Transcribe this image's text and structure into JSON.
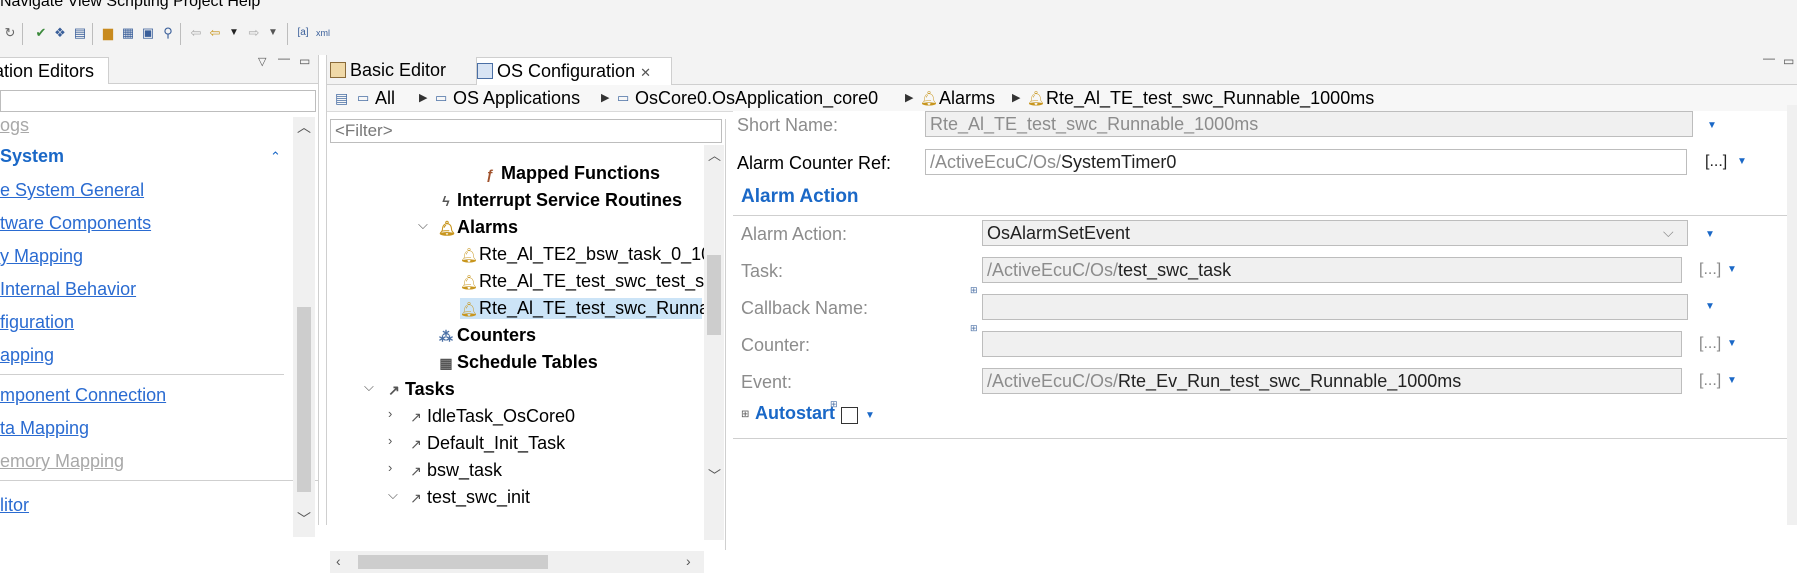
{
  "menu": {
    "text": "Navigate  View  Scripting  Project  Help"
  },
  "left_panel": {
    "tab_label": "ation Editors",
    "items": [
      {
        "label": "ogs",
        "style": "grey"
      },
      {
        "label": "System",
        "style": "sys"
      },
      {
        "label": "e System General",
        "style": "link"
      },
      {
        "label": "tware Components",
        "style": "link"
      },
      {
        "label": "y Mapping",
        "style": "link"
      },
      {
        "label": " Internal Behavior",
        "style": "link"
      },
      {
        "label": "figuration",
        "style": "link"
      },
      {
        "label": "apping",
        "style": "link"
      },
      {
        "label": "mponent Connection",
        "style": "link"
      },
      {
        "label": "ta Mapping",
        "style": "link"
      },
      {
        "label": "emory Mapping",
        "style": "grey"
      },
      {
        "label": "litor",
        "style": "link"
      }
    ]
  },
  "editor": {
    "tabs": [
      {
        "label": "Basic Editor"
      },
      {
        "label": "OS Configuration"
      }
    ],
    "breadcrumb": [
      "All",
      "OS Applications",
      "OsCore0.OsApplication_core0",
      "Alarms",
      "Rte_Al_TE_test_swc_Runnable_1000ms"
    ]
  },
  "tree": {
    "filter_placeholder": "<Filter>",
    "items": [
      {
        "label": "Mapped Functions",
        "icon": "function-icon"
      },
      {
        "label": "Interrupt Service Routines",
        "icon": "lightning-icon"
      },
      {
        "label": "Alarms",
        "icon": "bell-icon"
      },
      {
        "label": "Rte_Al_TE2_bsw_task_0_10",
        "icon": "bell-icon"
      },
      {
        "label": "Rte_Al_TE_test_swc_test_sw",
        "icon": "bell-icon"
      },
      {
        "label": "Rte_Al_TE_test_swc_Runna",
        "icon": "bell-icon"
      },
      {
        "label": "Counters",
        "icon": "counter-icon"
      },
      {
        "label": "Schedule Tables",
        "icon": "table-icon"
      },
      {
        "label": "Tasks",
        "icon": "hammer-icon"
      },
      {
        "label": "IdleTask_OsCore0",
        "icon": "hammer-icon"
      },
      {
        "label": "Default_Init_Task",
        "icon": "hammer-icon"
      },
      {
        "label": "bsw_task",
        "icon": "hammer-icon"
      },
      {
        "label": "test_swc_init",
        "icon": "hammer-icon"
      }
    ]
  },
  "form": {
    "short_name_label": "Short Name:",
    "short_name_value": "Rte_Al_TE_test_swc_Runnable_1000ms",
    "counter_ref_label": "Alarm Counter Ref:",
    "counter_ref_prefix": "/ActiveEcuC/Os/",
    "counter_ref_value": "SystemTimer0",
    "browse_label": "[...]",
    "section_alarm_action": "Alarm Action",
    "alarm_action_label": "Alarm Action:",
    "alarm_action_value": "OsAlarmSetEvent",
    "task_label": "Task:",
    "task_prefix": "/ActiveEcuC/Os/",
    "task_value": "test_swc_task",
    "callback_label": "Callback Name:",
    "counter_label": "Counter:",
    "event_label": "Event:",
    "event_prefix": "/ActiveEcuC/Os/",
    "event_value": "Rte_Ev_Run_test_swc_Runnable_1000ms",
    "section_autostart": "Autostart"
  }
}
